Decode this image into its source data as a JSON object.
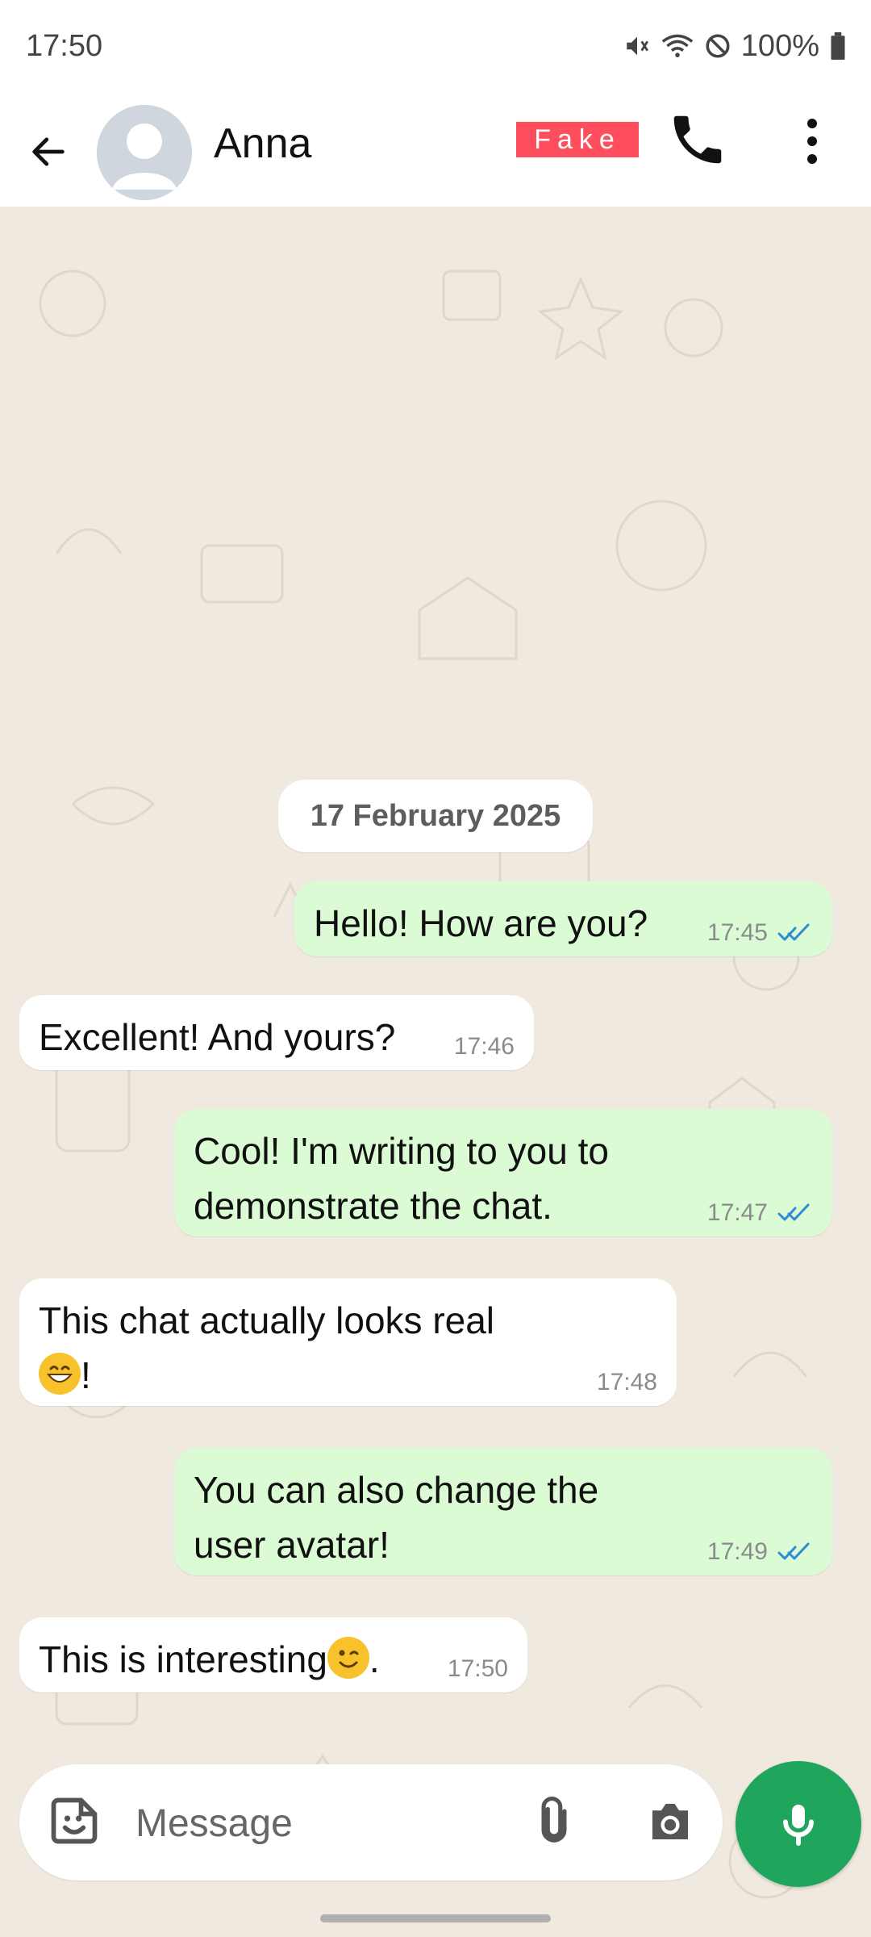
{
  "status_bar": {
    "time": "17:50",
    "battery": "100%"
  },
  "header": {
    "contact_name": "Anna",
    "badge": "Fake"
  },
  "date_chip": "17 February 2025",
  "messages": [
    {
      "side": "out",
      "text": "Hello! How are you?",
      "time": "17:45",
      "read": true
    },
    {
      "side": "in",
      "text": "Excellent! And yours?",
      "time": "17:46"
    },
    {
      "side": "out",
      "text": "Cool! I'm writing to you to demonstrate the chat.",
      "time": "17:47",
      "read": true
    },
    {
      "side": "in",
      "text": "This chat actually looks real",
      "text_suffix": "!",
      "emoji": "grinning-face",
      "time": "17:48"
    },
    {
      "side": "out",
      "text": "You can also change the user avatar!",
      "time": "17:49",
      "read": true
    },
    {
      "side": "in",
      "text": "This is interesting",
      "text_suffix": ".",
      "emoji": "winking-face",
      "time": "17:50"
    }
  ],
  "input": {
    "placeholder": "Message"
  },
  "colors": {
    "outgoing_bubble": "#dbfbd4",
    "incoming_bubble": "#ffffff",
    "read_tick": "#2f8bd5",
    "mic_button": "#1fa55c",
    "fake_badge": "#ff4f5e",
    "chat_background": "#efe9df"
  },
  "icons": {
    "back": "arrow-left-icon",
    "call": "phone-icon",
    "menu": "more-vertical-icon",
    "emoji": "sticker-icon",
    "attach": "paperclip-icon",
    "camera": "camera-icon",
    "mic": "microphone-icon"
  }
}
